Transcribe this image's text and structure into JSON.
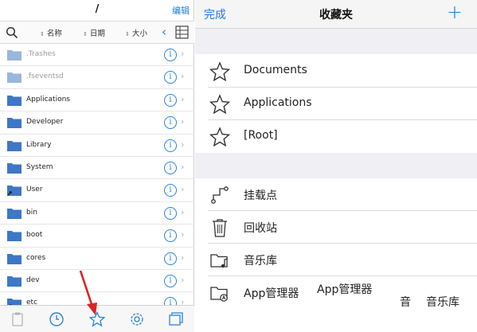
{
  "left_panel": {
    "title": "/",
    "edit_label": "编辑",
    "sort": {
      "name_label": "名称",
      "date_label": "日期",
      "size_label": "大小"
    },
    "rows": [
      {
        "name": ".Trashes",
        "dim": true
      },
      {
        "name": ".fseventsd",
        "dim": true
      },
      {
        "name": "Applications",
        "dim": false
      },
      {
        "name": "Developer",
        "dim": false
      },
      {
        "name": "Library",
        "dim": false
      },
      {
        "name": "System",
        "dim": false
      },
      {
        "name": "User",
        "dim": false
      },
      {
        "name": "bin",
        "dim": false
      },
      {
        "name": "boot",
        "dim": false
      },
      {
        "name": "cores",
        "dim": false
      },
      {
        "name": "dev",
        "dim": false
      },
      {
        "name": "etc",
        "dim": false
      }
    ],
    "info_glyph": "i",
    "tabbar_icons": [
      "clipboard-icon",
      "clock-icon",
      "star-icon",
      "gear-icon",
      "windows-icon"
    ]
  },
  "right_panel": {
    "done_label": "完成",
    "title": "收藏夹",
    "add_glyph": "+",
    "favorites": [
      {
        "label": "Documents",
        "icon": "star-icon"
      },
      {
        "label": "Applications",
        "icon": "star-icon"
      },
      {
        "label": "[Root]",
        "icon": "star-icon"
      }
    ],
    "places": [
      {
        "label": "挂载点",
        "icon": "mount-point-icon"
      },
      {
        "label": "回收站",
        "icon": "trash-icon"
      },
      {
        "label": "音乐库",
        "icon": "music-folder-icon"
      },
      {
        "label": "App管理器",
        "icon": "app-folder-icon"
      }
    ],
    "ghost_texts": {
      "app_manager_echo": "App管理器",
      "music_short": "音",
      "music_echo": "音乐库"
    }
  },
  "colors": {
    "accent": "#1a7ae6",
    "folder": "#3d77c6",
    "folder_dim": "#9ab6dc",
    "annotation_arrow": "#d9242a",
    "band": "#efeff4"
  }
}
